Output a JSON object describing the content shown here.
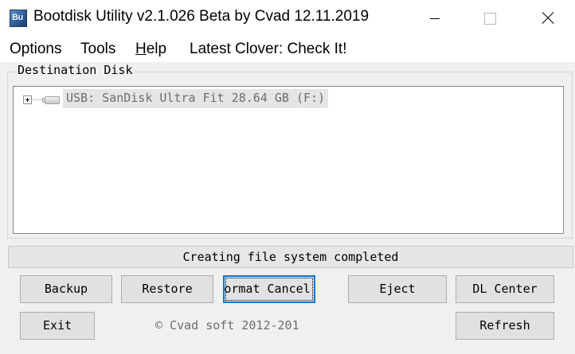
{
  "window": {
    "title": "Bootdisk Utility v2.1.026 Beta by Cvad 12.11.2019",
    "icon": "Bu"
  },
  "menu": {
    "options": "Options",
    "tools": "Tools",
    "help_first": "H",
    "help_rest": "elp",
    "clover": "Latest Clover: Check It!"
  },
  "destination": {
    "label": "Destination Disk",
    "disks": [
      {
        "label": "USB: SanDisk Ultra Fit 28.64 GB (F:)",
        "icon": "usb-drive-icon"
      }
    ]
  },
  "status": {
    "text": "Creating file system completed"
  },
  "buttons": {
    "backup": "Backup",
    "restore": "Restore",
    "format": "Format Cancel",
    "eject": "Eject",
    "dl_center": "DL Center",
    "exit": "Exit",
    "refresh": "Refresh"
  },
  "footer": {
    "copyright": "© Cvad soft 2012-201"
  },
  "colors": {
    "focus_border": "#0078d7",
    "window_bg": "#f0f0f0",
    "button_bg": "#e1e1e1"
  }
}
